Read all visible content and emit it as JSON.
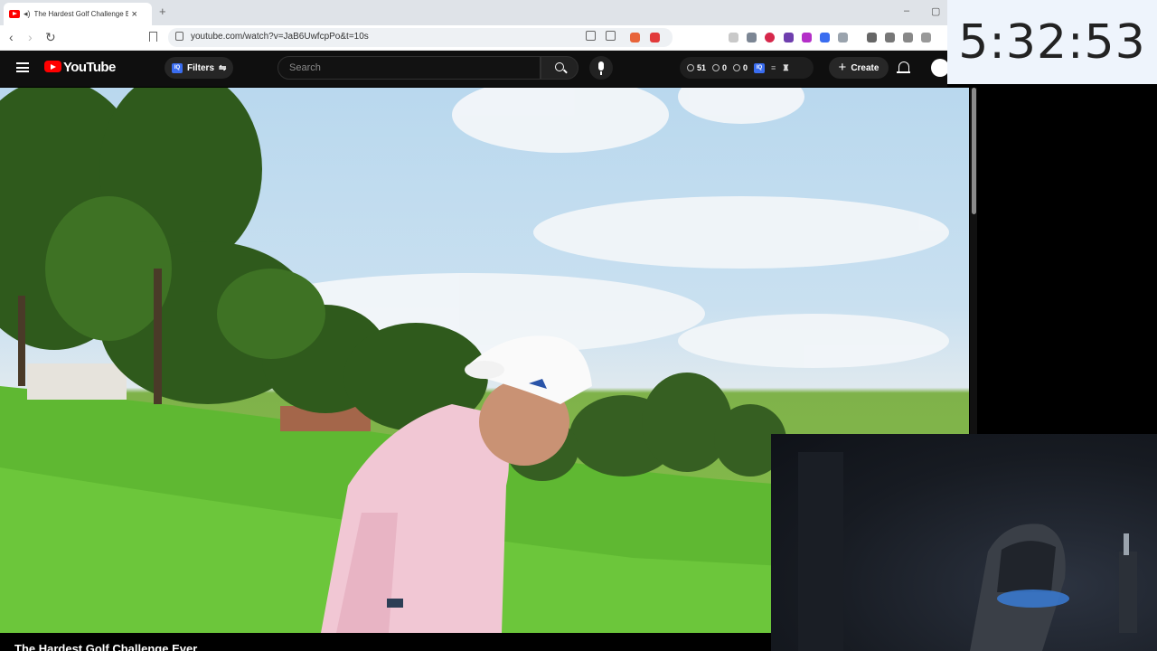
{
  "browser": {
    "tab_title": "The Hardest Golf Challenge E",
    "close_glyph": "×",
    "new_tab_glyph": "+",
    "url": "youtube.com/watch?v=JaB6UwfcpPo&t=10s",
    "nav": {
      "back": "‹",
      "forward": "›",
      "reload": "↻"
    },
    "window_controls": {
      "minimize": "–",
      "maximize": "▢"
    }
  },
  "youtube": {
    "logo_text": "YouTube",
    "filters_label": "Filters",
    "filters_icon": "⇋",
    "iq_badge": "IQ",
    "search_placeholder": "Search",
    "stats": {
      "count_a": "51",
      "count_b": "0",
      "count_c": "0"
    },
    "create_label": "Create",
    "create_icon": "+"
  },
  "overlay": {
    "clock": "5:32:53"
  },
  "video": {
    "title": "The Hardest Golf Challenge Ever"
  },
  "colors": {
    "brand_red": "#ff0000",
    "header_bg": "#0f0f0f",
    "clock_bg": "#eef4fc"
  }
}
